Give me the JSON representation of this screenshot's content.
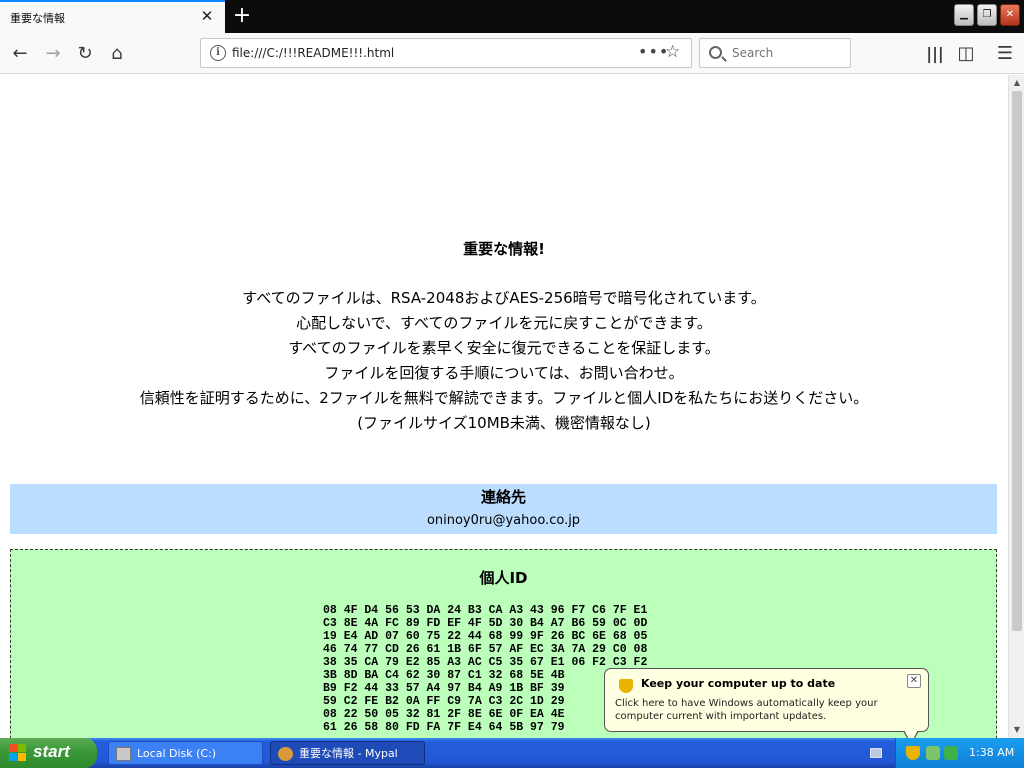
{
  "browser": {
    "tab_title": "重要な情報",
    "tab_close": "✕",
    "new_tab": "+",
    "url": "file:///C:/!!!README!!!.html",
    "url_more": "•••",
    "search_placeholder": "Search"
  },
  "page": {
    "headline": "重要な情報!",
    "messages": [
      "すべてのファイルは、RSA-2048およびAES-256暗号で暗号化されています。",
      "心配しないで、すべてのファイルを元に戻すことができます。",
      "すべてのファイルを素早く安全に復元できることを保証します。",
      "ファイルを回復する手順については、お問い合わせ。",
      "信頼性を証明するために、2ファイルを無料で解読できます。ファイルと個人IDを私たちにお送りください。",
      "(ファイルサイズ10MB未満、機密情報なし)"
    ],
    "contact": {
      "title": "連絡先",
      "email": "oninoy0ru@yahoo.co.jp"
    },
    "personal_id": {
      "title": "個人ID",
      "hex_lines": [
        "08 4F D4 56 53 DA 24 B3 CA A3 43 96 F7 C6 7F E1",
        "C3 8E 4A FC 89 FD EF 4F 5D 30 B4 A7 B6 59 0C 0D",
        "19 E4 AD 07 60 75 22 44 68 99 9F 26 BC 6E 68 05",
        "46 74 77 CD 26 61 1B 6F 57 AF EC 3A 7A 29 C0 08",
        "38 35 CA 79 E2 85 A3 AC C5 35 67 E1 06 F2 C3 F2",
        "3B 8D BA C4 62 30 87 C1 32 68 5E 4B",
        "B9 F2 44 33 57 A4 97 B4 A9 1B BF 39",
        "59 C2 FE B2 0A FF C9 7A C3 2C 1D 29",
        "08 22 50 05 32 81 2F 8E 6E 0F EA 4E",
        "61 26 58 80 FD FA 7F E4 64 5B 97 79"
      ]
    }
  },
  "balloon": {
    "title": "Keep your computer up to date",
    "text": "Click here to have Windows automatically keep your computer current with important updates.",
    "close": "✕"
  },
  "taskbar": {
    "start_label": "start",
    "tasks": [
      {
        "label": "Local Disk (C:)",
        "active": false
      },
      {
        "label": "重要な情報 - Mypal",
        "active": true
      }
    ],
    "clock": "1:38 AM"
  }
}
